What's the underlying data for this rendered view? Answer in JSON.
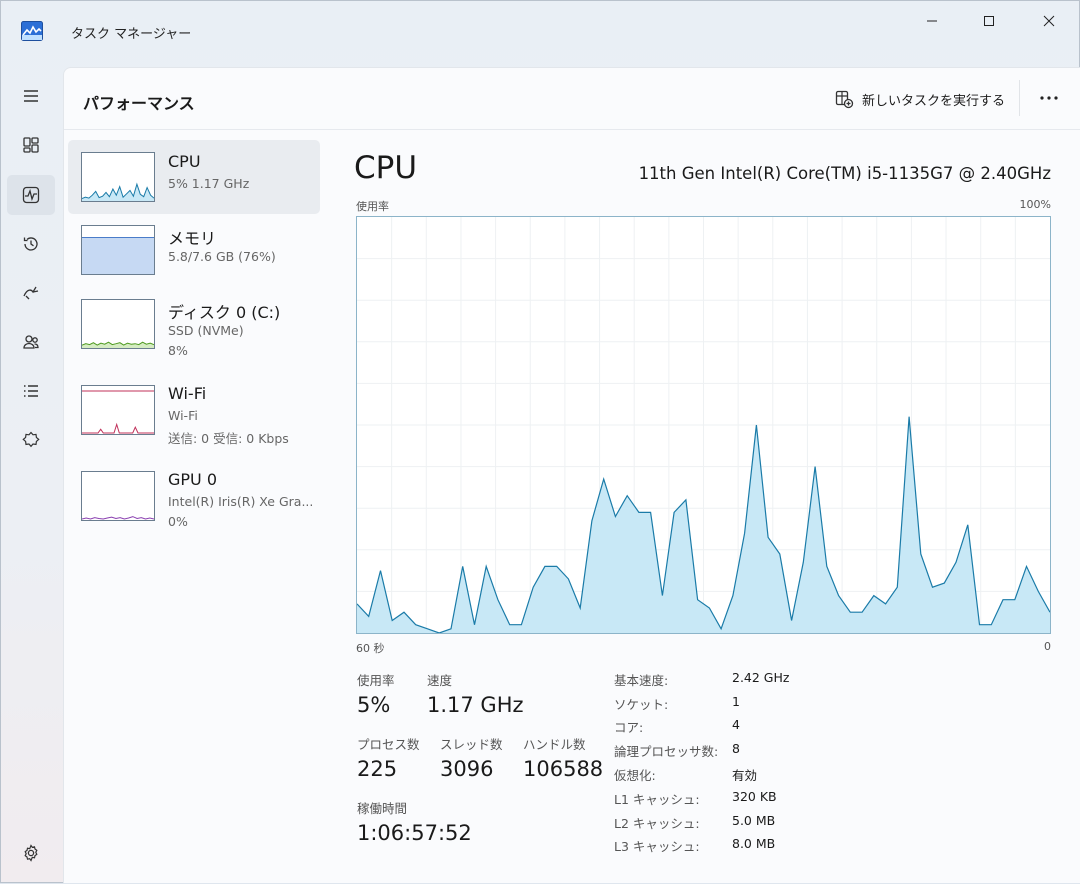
{
  "window": {
    "title": "タスク マネージャー",
    "colors": {
      "accent": "#1d5aa8",
      "cpu_line": "#1a7ba8",
      "cpu_fill": "#c8e8f6",
      "grid": "#eef1f3"
    }
  },
  "window_controls": {
    "minimize_icon": "minimize-icon",
    "maximize_icon": "maximize-icon",
    "close_icon": "close-icon"
  },
  "rail": {
    "items": [
      {
        "icon": "hamburger-menu-icon"
      },
      {
        "icon": "processes-icon"
      },
      {
        "icon": "performance-icon",
        "active": true
      },
      {
        "icon": "app-history-icon"
      },
      {
        "icon": "startup-apps-icon"
      },
      {
        "icon": "users-icon"
      },
      {
        "icon": "details-icon"
      },
      {
        "icon": "services-icon"
      },
      {
        "icon": "settings-icon"
      }
    ]
  },
  "header": {
    "title": "パフォーマンス",
    "run_task_label": "新しいタスクを実行する",
    "more_icon": "more-options-icon"
  },
  "devices": [
    {
      "name": "CPU",
      "sub1": "5%  1.17 GHz",
      "sub2": "",
      "selected": true,
      "color": "#1a7ba8",
      "thumb_values": [
        5,
        8,
        6,
        12,
        20,
        7,
        10,
        18,
        9,
        25,
        12,
        30,
        8,
        15,
        22,
        10,
        35,
        14,
        9,
        28,
        12,
        6
      ]
    },
    {
      "name": "メモリ",
      "sub1": "5.8/7.6 GB (76%)",
      "sub2": "",
      "color": "#4a7cc9",
      "fill": 76
    },
    {
      "name": "ディスク 0 (C:)",
      "sub1": "SSD (NVMe)",
      "sub2": "8%",
      "color": "#4d9a1f"
    },
    {
      "name": "Wi-Fi",
      "sub1": "Wi-Fi",
      "sub2": "送信: 0  受信: 0 Kbps",
      "color": "#c0305a"
    },
    {
      "name": "GPU 0",
      "sub1": "Intel(R) Iris(R) Xe Gra...",
      "sub2": "0%",
      "color": "#8a3fb0"
    }
  ],
  "cpu": {
    "title": "CPU",
    "model": "11th Gen Intel(R) Core(TM) i5-1135G7 @ 2.40GHz",
    "graph": {
      "y_label": "使用率",
      "y_max_label": "100%",
      "x_left_label": "60 秒",
      "x_right_label": "0"
    },
    "stats": {
      "usage_label": "使用率",
      "usage_value": "5%",
      "speed_label": "速度",
      "speed_value": "1.17 GHz",
      "processes_label": "プロセス数",
      "processes_value": "225",
      "threads_label": "スレッド数",
      "threads_value": "3096",
      "handles_label": "ハンドル数",
      "handles_value": "106588",
      "uptime_label": "稼働時間",
      "uptime_value": "1:06:57:52"
    },
    "specs": [
      {
        "k": "基本速度:",
        "v": "2.42 GHz"
      },
      {
        "k": "ソケット:",
        "v": "1"
      },
      {
        "k": "コア:",
        "v": "4"
      },
      {
        "k": "論理プロセッサ数:",
        "v": "8"
      },
      {
        "k": "仮想化:",
        "v": "有効"
      },
      {
        "k": "L1 キャッシュ:",
        "v": "320 KB"
      },
      {
        "k": "L2 キャッシュ:",
        "v": "5.0 MB"
      },
      {
        "k": "L3 キャッシュ:",
        "v": "8.0 MB"
      }
    ]
  },
  "chart_data": {
    "type": "area",
    "title": "CPU",
    "ylabel": "使用率",
    "xlabel": "",
    "x_range_seconds": [
      60,
      0
    ],
    "ylim": [
      0,
      100
    ],
    "grid": true,
    "series": [
      {
        "values": [
          7,
          4,
          15,
          3,
          5,
          2,
          1,
          0,
          1,
          16,
          2,
          16,
          8,
          2,
          2,
          11,
          16,
          16,
          13,
          6,
          27,
          37,
          28,
          33,
          29,
          29,
          9,
          29,
          32,
          8,
          6,
          1,
          9,
          24,
          50,
          23,
          19,
          3,
          17,
          40,
          16,
          9,
          5,
          5,
          9,
          7,
          11,
          52,
          19,
          11,
          12,
          17,
          26,
          2,
          2,
          8,
          8,
          16,
          10,
          5
        ]
      }
    ]
  }
}
